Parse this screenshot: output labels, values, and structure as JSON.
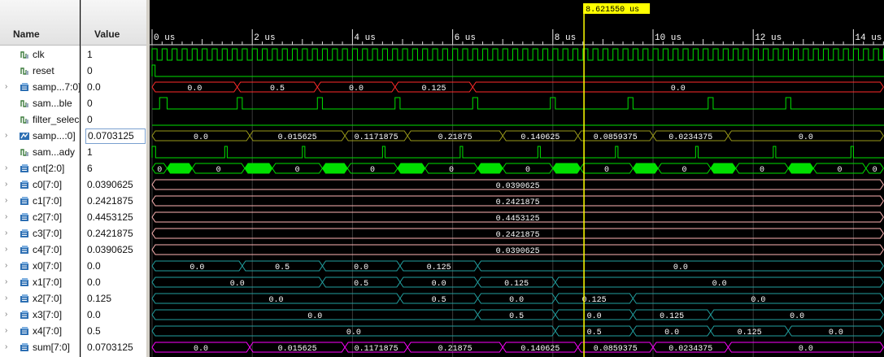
{
  "headers": {
    "name": "Name",
    "value": "Value"
  },
  "cursor": {
    "label": "8.621550 us",
    "time_us": 8.62155
  },
  "time_axis": {
    "labels": [
      "0 us",
      "2 us",
      "4 us",
      "6 us",
      "8 us",
      "10 us",
      "12 us",
      "14 us"
    ]
  },
  "signals": [
    {
      "name": "clk",
      "value": "1",
      "kind": "bit",
      "expander": false
    },
    {
      "name": "reset",
      "value": "0",
      "kind": "bit",
      "expander": false
    },
    {
      "name": "samp...7:0]",
      "value": "0.0",
      "kind": "bus",
      "expander": true
    },
    {
      "name": "sam...ble",
      "value": "0",
      "kind": "bit",
      "expander": false
    },
    {
      "name": "filter_selec",
      "value": "0",
      "kind": "bit",
      "expander": false
    },
    {
      "name": "samp...:0]",
      "value": "0.0703125",
      "kind": "bus",
      "expander": true,
      "selected": true
    },
    {
      "name": "sam...ady",
      "value": "1",
      "kind": "bit",
      "expander": false
    },
    {
      "name": "cnt[2:0]",
      "value": "6",
      "kind": "bus",
      "expander": true
    },
    {
      "name": "c0[7:0]",
      "value": "0.0390625",
      "kind": "bus",
      "expander": true
    },
    {
      "name": "c1[7:0]",
      "value": "0.2421875",
      "kind": "bus",
      "expander": true
    },
    {
      "name": "c2[7:0]",
      "value": "0.4453125",
      "kind": "bus",
      "expander": true
    },
    {
      "name": "c3[7:0]",
      "value": "0.2421875",
      "kind": "bus",
      "expander": true
    },
    {
      "name": "c4[7:0]",
      "value": "0.0390625",
      "kind": "bus",
      "expander": true
    },
    {
      "name": "x0[7:0]",
      "value": "0.0",
      "kind": "bus",
      "expander": true
    },
    {
      "name": "x1[7:0]",
      "value": "0.0",
      "kind": "bus",
      "expander": true
    },
    {
      "name": "x2[7:0]",
      "value": "0.125",
      "kind": "bus",
      "expander": true
    },
    {
      "name": "x3[7:0]",
      "value": "0.0",
      "kind": "bus",
      "expander": true
    },
    {
      "name": "x4[7:0]",
      "value": "0.5",
      "kind": "bus",
      "expander": true
    },
    {
      "name": "sum[7:0]",
      "value": "0.0703125",
      "kind": "bus",
      "expander": true
    }
  ],
  "colors": {
    "clock": "#00e000",
    "bit": "#00e000",
    "red_bus": "#ff2a2a",
    "olive_bus": "#9a9a1a",
    "green_bus": "#00e000",
    "pink_bus": "#ffb4b4",
    "cyan_bus": "#22a0a0",
    "magenta_bus": "#ff00ff",
    "cursor": "#ffff00",
    "grid": "#3a3a3a"
  },
  "waves": {
    "bit_pulses": {
      "reset": [
        [
          0.0,
          0.06
        ]
      ],
      "sam...ble": [
        [
          0.15,
          0.3
        ],
        [
          1.7,
          1.8
        ],
        [
          3.3,
          3.4
        ],
        [
          4.85,
          4.95
        ],
        [
          6.4,
          6.5
        ],
        [
          7.95,
          8.05
        ],
        [
          9.5,
          9.6
        ],
        [
          11.1,
          11.2
        ],
        [
          12.65,
          12.75
        ]
      ],
      "sam...ady": [
        [
          0.0,
          0.07
        ],
        [
          1.45,
          1.5
        ],
        [
          3.0,
          3.05
        ],
        [
          4.6,
          4.65
        ],
        [
          6.15,
          6.2
        ],
        [
          7.7,
          7.75
        ],
        [
          9.25,
          9.3
        ],
        [
          10.85,
          10.9
        ],
        [
          12.4,
          12.45
        ],
        [
          13.95,
          14.0
        ]
      ]
    },
    "buses": [
      {
        "row": 2,
        "color": "red_bus",
        "segments": [
          {
            "t0": 0.0,
            "t1": 1.7,
            "label": "0.0"
          },
          {
            "t0": 1.7,
            "t1": 3.3,
            "label": "0.5"
          },
          {
            "t0": 3.3,
            "t1": 4.85,
            "label": "0.0"
          },
          {
            "t0": 4.85,
            "t1": 6.4,
            "label": "0.125"
          },
          {
            "t0": 6.4,
            "t1": 14.6,
            "label": "0.0"
          }
        ]
      },
      {
        "row": 5,
        "color": "olive_bus",
        "segments": [
          {
            "t0": 0.0,
            "t1": 1.95,
            "label": "0.0"
          },
          {
            "t0": 1.95,
            "t1": 3.85,
            "label": "0.015625"
          },
          {
            "t0": 3.85,
            "t1": 5.1,
            "label": "0.1171875"
          },
          {
            "t0": 5.1,
            "t1": 7.0,
            "label": "0.21875"
          },
          {
            "t0": 7.0,
            "t1": 8.5,
            "label": "0.140625"
          },
          {
            "t0": 8.5,
            "t1": 10.0,
            "label": "0.0859375"
          },
          {
            "t0": 10.0,
            "t1": 11.5,
            "label": "0.0234375"
          },
          {
            "t0": 11.5,
            "t1": 14.6,
            "label": "0.0"
          }
        ]
      },
      {
        "row": 7,
        "color": "green_bus",
        "segments": [
          {
            "t0": 0.0,
            "t1": 0.3,
            "label": "0"
          },
          {
            "t0": 0.3,
            "t1": 0.8,
            "label": ""
          },
          {
            "t0": 0.8,
            "t1": 1.85,
            "label": "0"
          },
          {
            "t0": 1.85,
            "t1": 2.4,
            "label": ""
          },
          {
            "t0": 2.4,
            "t1": 3.4,
            "label": "0"
          },
          {
            "t0": 3.4,
            "t1": 3.9,
            "label": ""
          },
          {
            "t0": 3.9,
            "t1": 4.9,
            "label": "0"
          },
          {
            "t0": 4.9,
            "t1": 5.45,
            "label": ""
          },
          {
            "t0": 5.45,
            "t1": 6.5,
            "label": "0"
          },
          {
            "t0": 6.5,
            "t1": 7.0,
            "label": ""
          },
          {
            "t0": 7.0,
            "t1": 8.0,
            "label": "0"
          },
          {
            "t0": 8.0,
            "t1": 8.55,
            "label": ""
          },
          {
            "t0": 8.55,
            "t1": 9.6,
            "label": "0"
          },
          {
            "t0": 9.6,
            "t1": 10.1,
            "label": ""
          },
          {
            "t0": 10.1,
            "t1": 11.15,
            "label": "0"
          },
          {
            "t0": 11.15,
            "t1": 11.65,
            "label": ""
          },
          {
            "t0": 11.65,
            "t1": 12.7,
            "label": "0"
          },
          {
            "t0": 12.7,
            "t1": 13.2,
            "label": ""
          },
          {
            "t0": 13.2,
            "t1": 14.25,
            "label": "0"
          },
          {
            "t0": 14.25,
            "t1": 14.6,
            "label": "0"
          }
        ]
      },
      {
        "row": 8,
        "color": "pink_bus",
        "segments": [
          {
            "t0": 0.0,
            "t1": 14.6,
            "label": "0.0390625"
          }
        ]
      },
      {
        "row": 9,
        "color": "pink_bus",
        "segments": [
          {
            "t0": 0.0,
            "t1": 14.6,
            "label": "0.2421875"
          }
        ]
      },
      {
        "row": 10,
        "color": "pink_bus",
        "segments": [
          {
            "t0": 0.0,
            "t1": 14.6,
            "label": "0.4453125"
          }
        ]
      },
      {
        "row": 11,
        "color": "pink_bus",
        "segments": [
          {
            "t0": 0.0,
            "t1": 14.6,
            "label": "0.2421875"
          }
        ]
      },
      {
        "row": 12,
        "color": "pink_bus",
        "segments": [
          {
            "t0": 0.0,
            "t1": 14.6,
            "label": "0.0390625"
          }
        ]
      },
      {
        "row": 13,
        "color": "cyan_bus",
        "segments": [
          {
            "t0": 0.0,
            "t1": 1.8,
            "label": "0.0"
          },
          {
            "t0": 1.8,
            "t1": 3.4,
            "label": "0.5"
          },
          {
            "t0": 3.4,
            "t1": 4.95,
            "label": "0.0"
          },
          {
            "t0": 4.95,
            "t1": 6.5,
            "label": "0.125"
          },
          {
            "t0": 6.5,
            "t1": 14.6,
            "label": "0.0"
          }
        ]
      },
      {
        "row": 14,
        "color": "cyan_bus",
        "segments": [
          {
            "t0": 0.0,
            "t1": 3.4,
            "label": "0.0"
          },
          {
            "t0": 3.4,
            "t1": 4.95,
            "label": "0.5"
          },
          {
            "t0": 4.95,
            "t1": 6.5,
            "label": "0.0"
          },
          {
            "t0": 6.5,
            "t1": 8.05,
            "label": "0.125"
          },
          {
            "t0": 8.05,
            "t1": 14.6,
            "label": "0.0"
          }
        ]
      },
      {
        "row": 15,
        "color": "cyan_bus",
        "segments": [
          {
            "t0": 0.0,
            "t1": 4.95,
            "label": "0.0"
          },
          {
            "t0": 4.95,
            "t1": 6.5,
            "label": "0.5"
          },
          {
            "t0": 6.5,
            "t1": 8.05,
            "label": "0.0"
          },
          {
            "t0": 8.05,
            "t1": 9.6,
            "label": "0.125"
          },
          {
            "t0": 9.6,
            "t1": 14.6,
            "label": "0.0"
          }
        ]
      },
      {
        "row": 16,
        "color": "cyan_bus",
        "segments": [
          {
            "t0": 0.0,
            "t1": 6.5,
            "label": "0.0"
          },
          {
            "t0": 6.5,
            "t1": 8.05,
            "label": "0.5"
          },
          {
            "t0": 8.05,
            "t1": 9.6,
            "label": "0.0"
          },
          {
            "t0": 9.6,
            "t1": 11.15,
            "label": "0.125"
          },
          {
            "t0": 11.15,
            "t1": 14.6,
            "label": "0.0"
          }
        ]
      },
      {
        "row": 17,
        "color": "cyan_bus",
        "segments": [
          {
            "t0": 0.0,
            "t1": 8.05,
            "label": "0.0"
          },
          {
            "t0": 8.05,
            "t1": 9.6,
            "label": "0.5"
          },
          {
            "t0": 9.6,
            "t1": 11.15,
            "label": "0.0"
          },
          {
            "t0": 11.15,
            "t1": 12.7,
            "label": "0.125"
          },
          {
            "t0": 12.7,
            "t1": 14.6,
            "label": "0.0"
          }
        ]
      },
      {
        "row": 18,
        "color": "magenta_bus",
        "segments": [
          {
            "t0": 0.0,
            "t1": 1.95,
            "label": "0.0"
          },
          {
            "t0": 1.95,
            "t1": 3.85,
            "label": "0.015625"
          },
          {
            "t0": 3.85,
            "t1": 5.1,
            "label": "0.1171875"
          },
          {
            "t0": 5.1,
            "t1": 7.0,
            "label": "0.21875"
          },
          {
            "t0": 7.0,
            "t1": 8.5,
            "label": "0.140625"
          },
          {
            "t0": 8.5,
            "t1": 10.0,
            "label": "0.0859375"
          },
          {
            "t0": 10.0,
            "t1": 11.5,
            "label": "0.0234375"
          },
          {
            "t0": 11.5,
            "t1": 14.6,
            "label": "0.0"
          }
        ]
      }
    ]
  }
}
